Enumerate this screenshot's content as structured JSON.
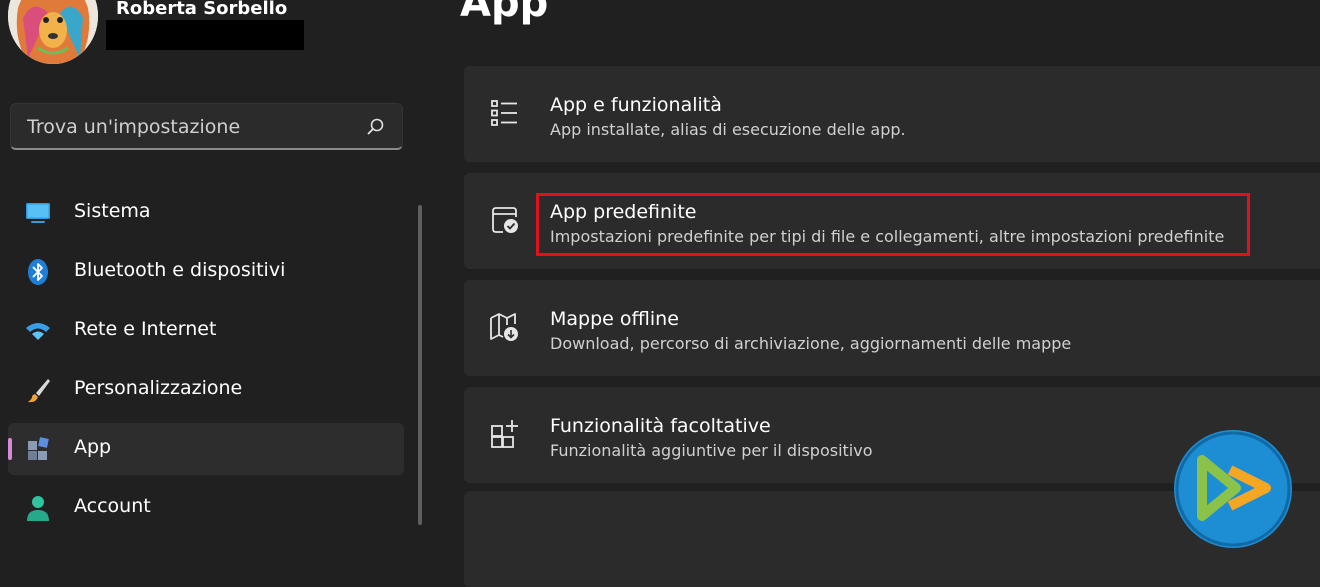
{
  "user": {
    "name": "Roberta Sorbello"
  },
  "search": {
    "placeholder": "Trova un'impostazione",
    "icon": "search-icon"
  },
  "nav": {
    "items": [
      {
        "label": "Sistema",
        "icon": "monitor-icon",
        "selected": false
      },
      {
        "label": "Bluetooth e dispositivi",
        "icon": "bluetooth-icon",
        "selected": false
      },
      {
        "label": "Rete e Internet",
        "icon": "wifi-icon",
        "selected": false
      },
      {
        "label": "Personalizzazione",
        "icon": "paintbrush-icon",
        "selected": false
      },
      {
        "label": "App",
        "icon": "apps-icon",
        "selected": true
      },
      {
        "label": "Account",
        "icon": "person-icon",
        "selected": false
      }
    ]
  },
  "page": {
    "title": "App"
  },
  "cards": [
    {
      "title": "App e funzionalità",
      "subtitle": "App installate, alias di esecuzione delle app.",
      "icon": "list-icon"
    },
    {
      "title": "App predefinite",
      "subtitle": "Impostazioni predefinite per tipi di file e collegamenti, altre impostazioni predefinite",
      "icon": "default-apps-icon",
      "highlighted": true
    },
    {
      "title": "Mappe offline",
      "subtitle": "Download, percorso di archiviazione, aggiornamenti delle mappe",
      "icon": "map-download-icon"
    },
    {
      "title": "Funzionalità facoltative",
      "subtitle": "Funzionalità aggiuntive per il dispositivo",
      "icon": "add-grid-icon"
    }
  ],
  "colors": {
    "background": "#202020",
    "card": "#2b2b2b",
    "accent": "#d98ad6",
    "highlight": "#e0111d",
    "logo": "#1e8ed4"
  }
}
